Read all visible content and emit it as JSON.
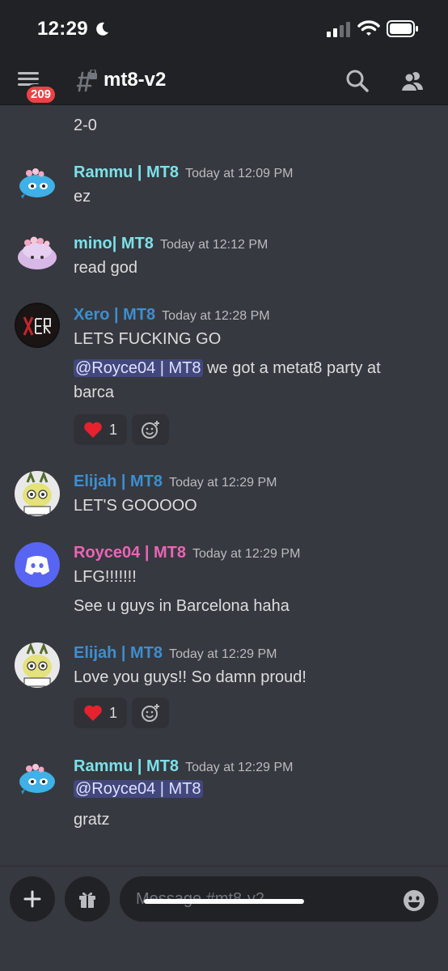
{
  "status_bar": {
    "time": "12:29"
  },
  "header": {
    "badge_count": "209",
    "channel_name": "mt8-v2"
  },
  "messages": [
    {
      "lines": [
        "2-0"
      ]
    },
    {
      "author": "Rammu | MT8",
      "timestamp": "Today at 12:09 PM",
      "color": "#7de0e8",
      "lines": [
        "ez"
      ]
    },
    {
      "author": "mino| MT8",
      "timestamp": "Today at 12:12 PM",
      "color": "#7de0e8",
      "lines": [
        "read god"
      ]
    },
    {
      "author": "Xero | MT8",
      "timestamp": "Today at 12:28 PM",
      "color": "#3e8ed0",
      "lines": [
        "LETS FUCKING GO",
        "we got a metat8 party at",
        "barca"
      ],
      "mention": "@Royce04 | MT8",
      "reaction": {
        "emoji": "heart",
        "count": "1"
      }
    },
    {
      "author": "Elijah | MT8",
      "timestamp": "Today at 12:29 PM",
      "color": "#3e8ed0",
      "lines": [
        "LET'S GOOOOO"
      ]
    },
    {
      "author": "Royce04 | MT8",
      "timestamp": "Today at 12:29 PM",
      "color": "#ec64b6",
      "lines": [
        "LFG!!!!!!!",
        "See u guys in Barcelona haha"
      ]
    },
    {
      "author": "Elijah | MT8",
      "timestamp": "Today at 12:29 PM",
      "color": "#3e8ed0",
      "lines": [
        "Love you guys!! So damn proud!"
      ],
      "reaction": {
        "emoji": "heart",
        "count": "1"
      }
    },
    {
      "author": "Rammu | MT8",
      "timestamp": "Today at 12:29 PM",
      "color": "#7de0e8",
      "mention": "@Royce04 | MT8",
      "lines": [
        "gratz"
      ]
    }
  ],
  "composer": {
    "placeholder": "Message #mt8-v2"
  },
  "colors": {
    "background": "#36393f",
    "header": "#202225",
    "accent": "#5865f2",
    "badge": "#ed4245"
  }
}
